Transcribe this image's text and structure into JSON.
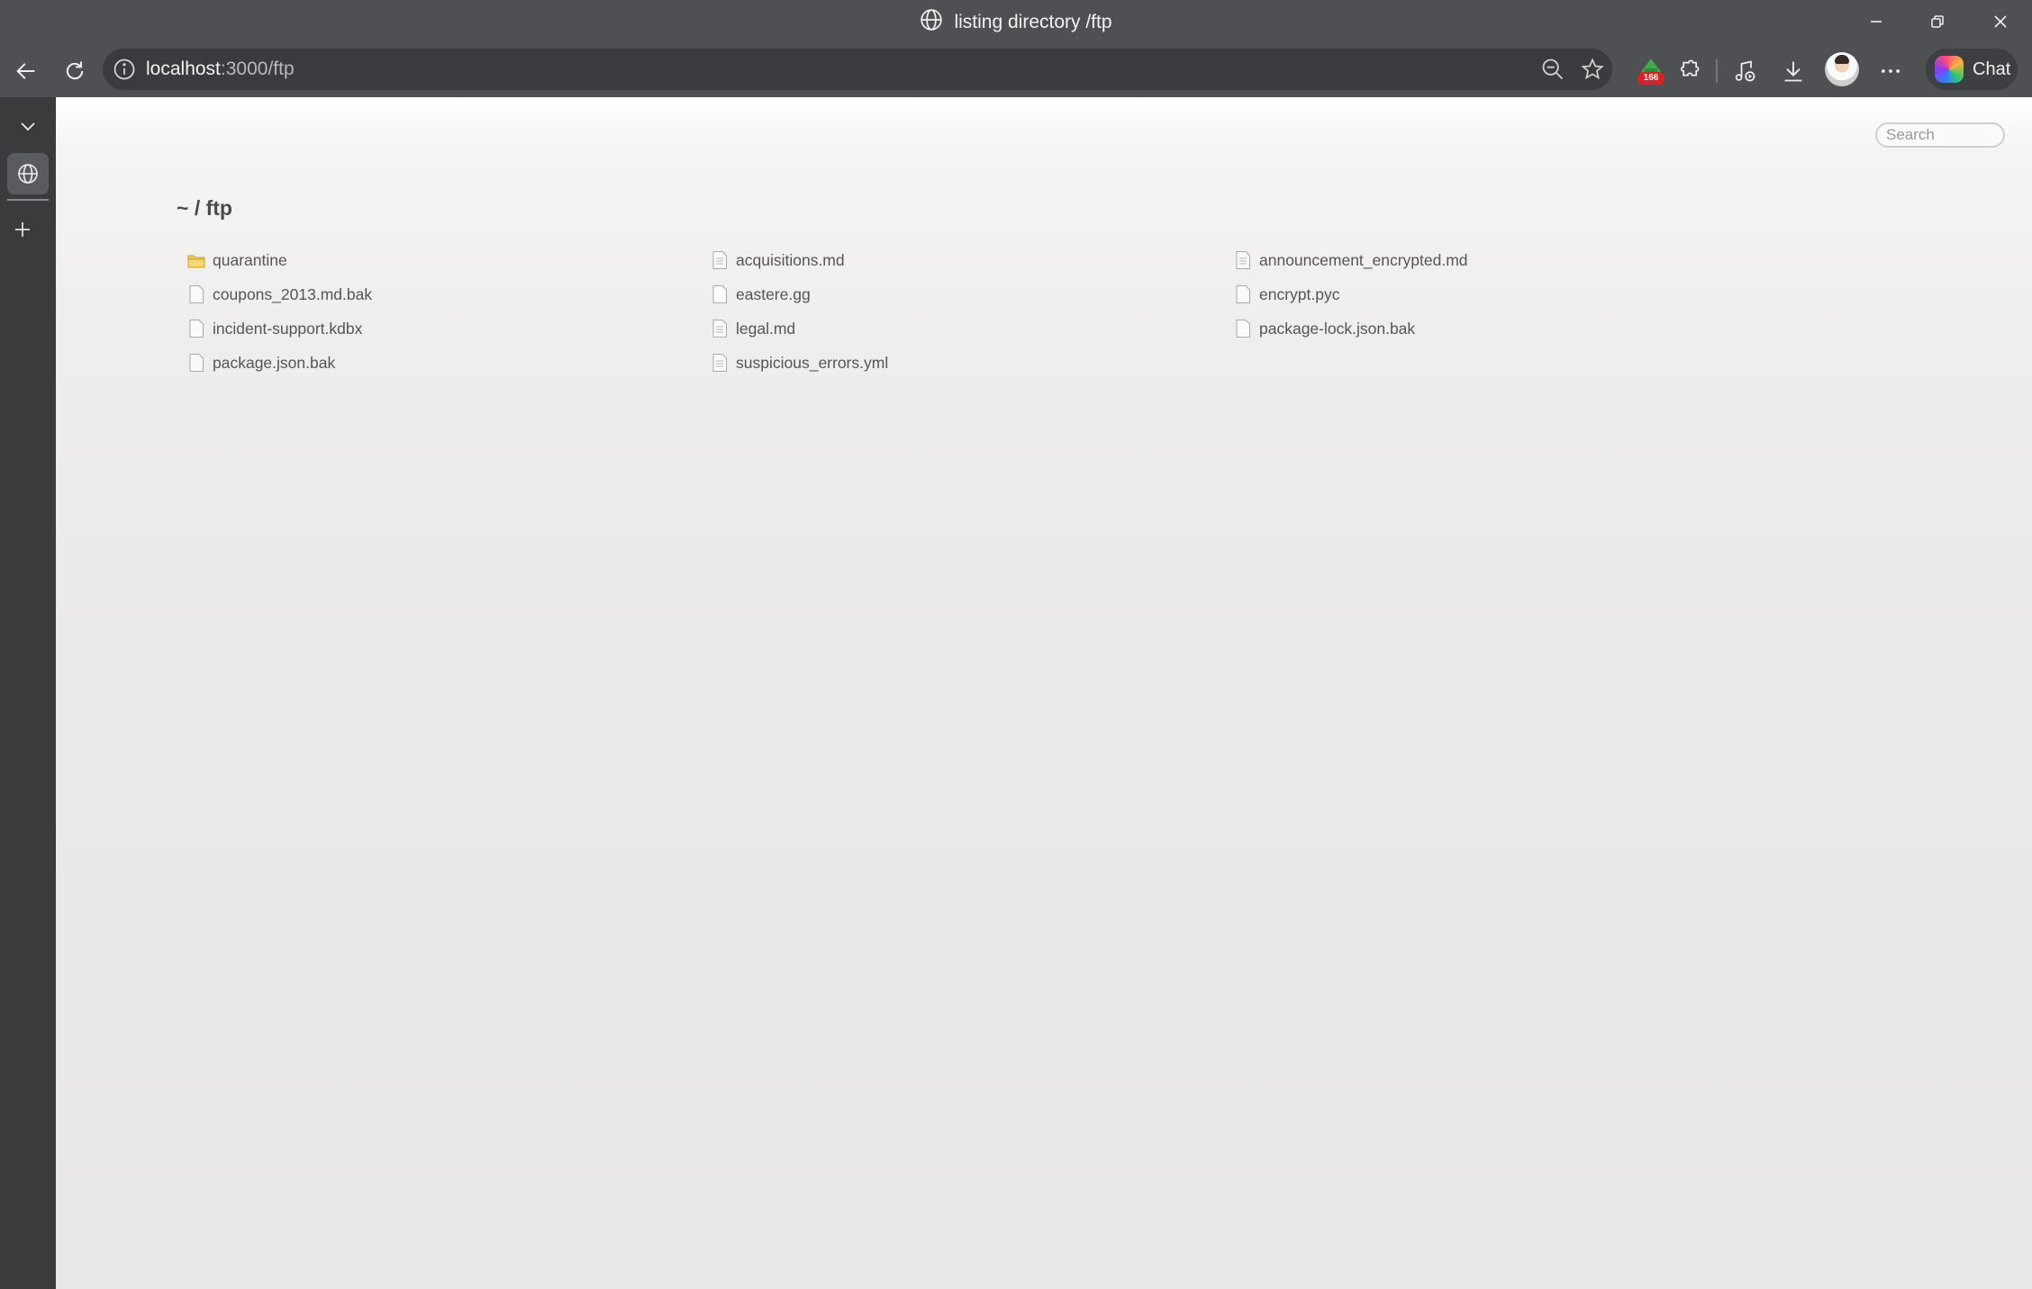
{
  "window": {
    "title": "listing directory /ftp"
  },
  "toolbar": {
    "url_host": "localhost",
    "url_rest": ":3000/ftp",
    "extension_badge": "166",
    "chat_label": "Chat"
  },
  "page": {
    "search_placeholder": "Search",
    "breadcrumb": "~ / ftp",
    "files": [
      {
        "name": "quarantine",
        "type": "folder"
      },
      {
        "name": "acquisitions.md",
        "type": "text"
      },
      {
        "name": "announcement_encrypted.md",
        "type": "text"
      },
      {
        "name": "coupons_2013.md.bak",
        "type": "file"
      },
      {
        "name": "eastere.gg",
        "type": "file"
      },
      {
        "name": "encrypt.pyc",
        "type": "file"
      },
      {
        "name": "incident-support.kdbx",
        "type": "file"
      },
      {
        "name": "legal.md",
        "type": "text"
      },
      {
        "name": "package-lock.json.bak",
        "type": "file"
      },
      {
        "name": "package.json.bak",
        "type": "file"
      },
      {
        "name": "suspicious_errors.yml",
        "type": "text"
      }
    ]
  },
  "colors": {
    "chrome": "#4f5054",
    "sidebar": "#3b3b3d",
    "folder": "#f2c94c",
    "badge": "#e02020"
  }
}
